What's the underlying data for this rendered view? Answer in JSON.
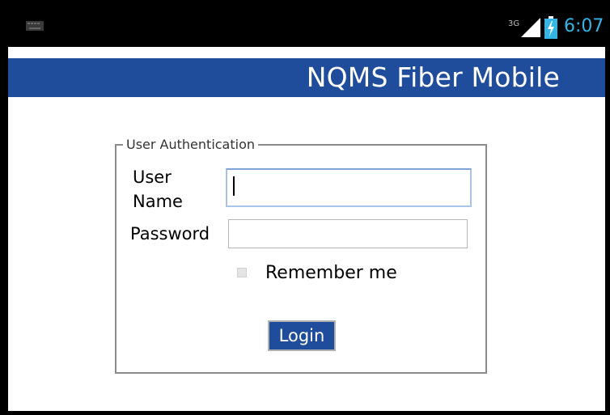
{
  "status_bar": {
    "time": "6:07",
    "network": "3G",
    "icons": [
      "keyboard-icon",
      "signal-icon",
      "battery-charging-icon"
    ],
    "time_color": "#33b5e5"
  },
  "app": {
    "title": "NQMS Fiber Mobile",
    "title_bar_color": "#1f4d9c"
  },
  "auth": {
    "legend": "User Authentication",
    "username_label": "User Name",
    "username_value": "",
    "password_label": "Password",
    "password_value": "",
    "remember_label": "Remember me",
    "remember_checked": false,
    "login_label": "Login"
  }
}
